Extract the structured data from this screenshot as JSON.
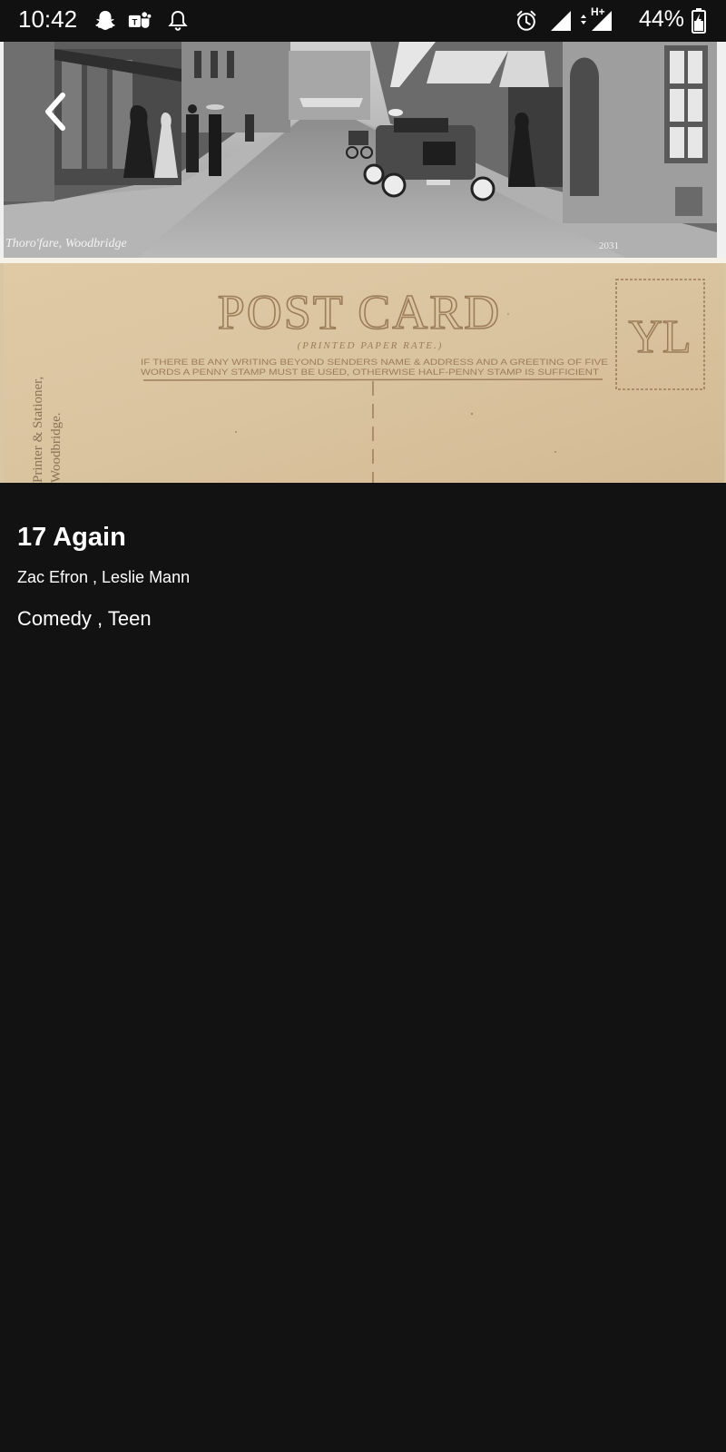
{
  "status_bar": {
    "time": "10:42",
    "battery": "44%",
    "network": "H+",
    "icons": [
      "snapchat-icon",
      "teams-icon",
      "bell-off-icon",
      "alarm-icon",
      "signal-icon",
      "data-signal-icon",
      "battery-charging-icon"
    ]
  },
  "hero": {
    "caption": "Thoro'fare, Woodbridge",
    "photo_number": "2031",
    "postcard_heading": "POST CARD",
    "postcard_rate": "(PRINTED PAPER RATE.)",
    "postcard_note_1": "IF THERE BE ANY WRITING BEYOND SENDERS NAME & ADDRESS AND A GREETING OF FIVE",
    "postcard_note_2": "WORDS A PENNY STAMP MUST BE USED, OTHERWISE HALF-PENNY STAMP IS SUFFICIENT",
    "publisher_line_1": "Printer & Stationer,",
    "publisher_line_2": "Woodbridge.",
    "stamp_monogram": "YL"
  },
  "movie": {
    "title": "17 Again",
    "cast": "Zac Efron , Leslie Mann",
    "genres": "Comedy , Teen"
  },
  "colors": {
    "background": "#121212",
    "text": "#ffffff",
    "postcard_ink": "#9c7d5a",
    "postcard_paper": "#ddc8a6"
  }
}
